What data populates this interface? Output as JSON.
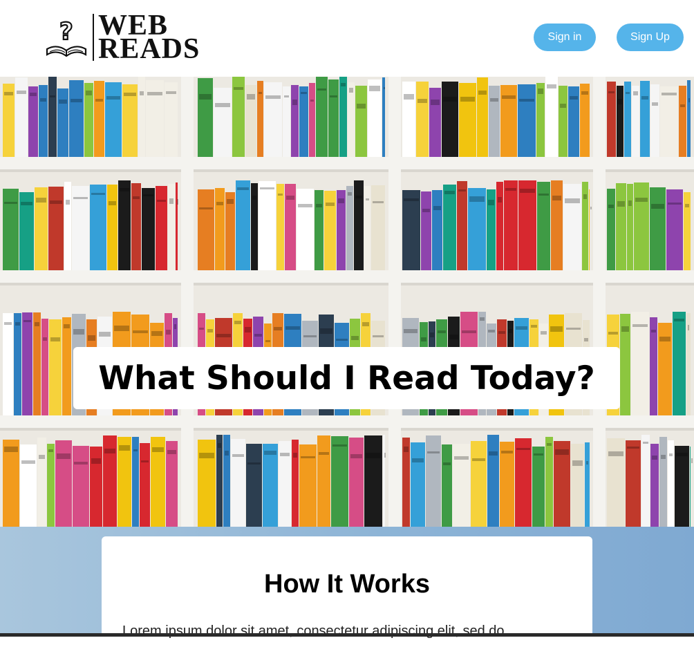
{
  "header": {
    "logo_line1": "WEB",
    "logo_line2": "READS",
    "signin_label": "Sign in",
    "signup_label": "Sign Up"
  },
  "hero": {
    "title": "What Should I Read Today?"
  },
  "how_it_works": {
    "heading": "How It Works",
    "body": "Lorem ipsum dolor sit amet, consectetur adipiscing elit, sed do"
  },
  "colors": {
    "button": "#55b4ea",
    "section_bg": "#8db4d6"
  }
}
